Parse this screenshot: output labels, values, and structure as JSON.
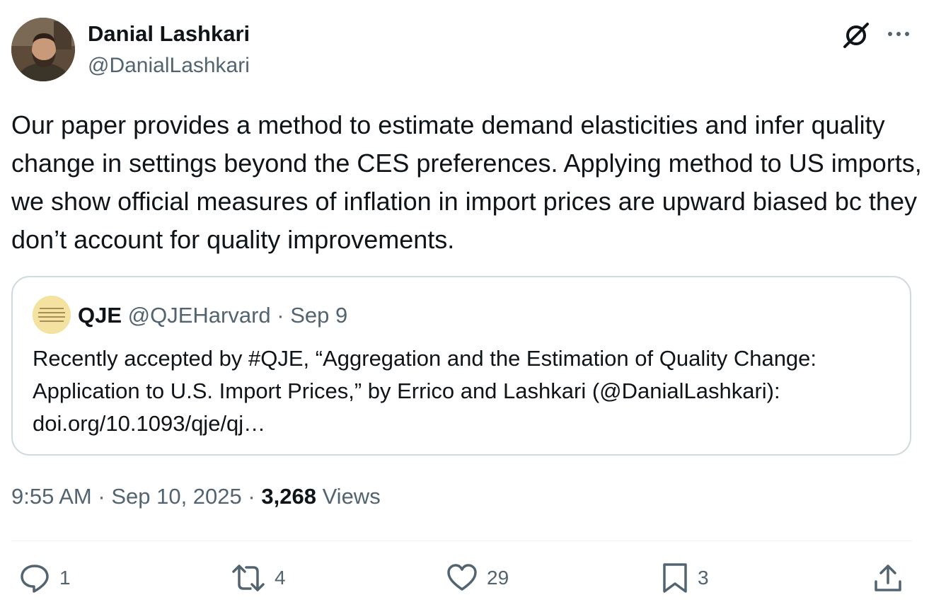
{
  "tweet": {
    "author": {
      "name": "Danial Lashkari",
      "handle": "@DanialLashkari",
      "avatar_icon": "user-avatar"
    },
    "header_icons": [
      "grok-icon",
      "more-icon"
    ],
    "text": "Our paper provides a method to estimate demand elasticities and infer quality change in settings beyond the CES preferences. Applying method to US imports, we show official measures of inflation in import prices are upward biased bc they don’t account for quality improvements.",
    "quoted": {
      "name": "QJE",
      "handle": "@QJEHarvard",
      "date": "Sep 9",
      "text": "Recently accepted by #QJE, “Aggregation and the Estimation of Quality Change: Application to U.S. Import Prices,” by Errico and Lashkari (@DanialLashkari): doi.org/10.1093/qje/qj…",
      "avatar_icon": "qje-logo"
    },
    "time": "9:55 AM",
    "date": "Sep 10, 2025",
    "views_count": "3,268",
    "views_label": "Views",
    "actions": {
      "replies": "1",
      "reposts": "4",
      "likes": "29",
      "bookmarks": "3"
    },
    "colors": {
      "text": "#0f1419",
      "secondary": "#536471",
      "border": "#cfd9de"
    }
  }
}
